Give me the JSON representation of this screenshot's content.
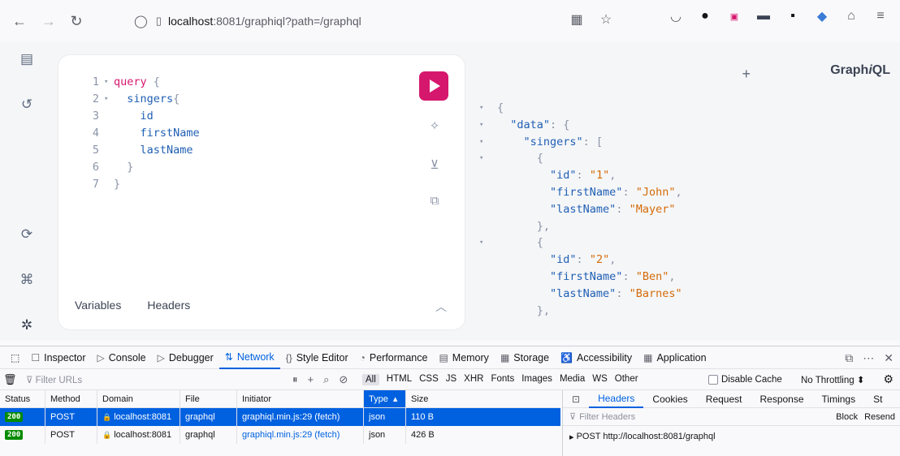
{
  "browser": {
    "url_host": "localhost",
    "url_rest": ":8081/graphiql?path=/graphql"
  },
  "editor": {
    "lines": [
      {
        "n": "1",
        "fold": "▾",
        "parts": [
          {
            "t": "query",
            "c": "kw"
          },
          {
            "t": " {",
            "c": "punc"
          }
        ]
      },
      {
        "n": "2",
        "fold": "▾",
        "parts": [
          {
            "t": "  singers",
            "c": "fld"
          },
          {
            "t": "{",
            "c": "punc"
          }
        ]
      },
      {
        "n": "3",
        "fold": "",
        "parts": [
          {
            "t": "    id",
            "c": "fld"
          }
        ]
      },
      {
        "n": "4",
        "fold": "",
        "parts": [
          {
            "t": "    firstName",
            "c": "fld"
          }
        ]
      },
      {
        "n": "5",
        "fold": "",
        "parts": [
          {
            "t": "    lastName",
            "c": "fld"
          }
        ]
      },
      {
        "n": "6",
        "fold": "",
        "parts": [
          {
            "t": "  }",
            "c": "punc"
          }
        ]
      },
      {
        "n": "7",
        "fold": "",
        "parts": [
          {
            "t": "}",
            "c": "punc"
          }
        ]
      }
    ],
    "tabs": [
      "Variables",
      "Headers"
    ]
  },
  "result": {
    "logo_prefix": "Graph",
    "logo_italic": "i",
    "logo_suffix": "QL",
    "lines": [
      {
        "fold": "▾",
        "parts": [
          {
            "t": "{",
            "c": "rpunc"
          }
        ]
      },
      {
        "fold": "▾",
        "parts": [
          {
            "t": "  ",
            "c": "rpunc"
          },
          {
            "t": "\"data\"",
            "c": "key"
          },
          {
            "t": ": {",
            "c": "rpunc"
          }
        ]
      },
      {
        "fold": "▾",
        "parts": [
          {
            "t": "    ",
            "c": "rpunc"
          },
          {
            "t": "\"singers\"",
            "c": "key"
          },
          {
            "t": ": [",
            "c": "rpunc"
          }
        ]
      },
      {
        "fold": "▾",
        "parts": [
          {
            "t": "      {",
            "c": "rpunc"
          }
        ]
      },
      {
        "fold": "",
        "parts": [
          {
            "t": "        ",
            "c": "rpunc"
          },
          {
            "t": "\"id\"",
            "c": "key"
          },
          {
            "t": ": ",
            "c": "rpunc"
          },
          {
            "t": "\"1\"",
            "c": "str"
          },
          {
            "t": ",",
            "c": "rpunc"
          }
        ]
      },
      {
        "fold": "",
        "parts": [
          {
            "t": "        ",
            "c": "rpunc"
          },
          {
            "t": "\"firstName\"",
            "c": "key"
          },
          {
            "t": ": ",
            "c": "rpunc"
          },
          {
            "t": "\"John\"",
            "c": "str"
          },
          {
            "t": ",",
            "c": "rpunc"
          }
        ]
      },
      {
        "fold": "",
        "parts": [
          {
            "t": "        ",
            "c": "rpunc"
          },
          {
            "t": "\"lastName\"",
            "c": "key"
          },
          {
            "t": ": ",
            "c": "rpunc"
          },
          {
            "t": "\"Mayer\"",
            "c": "str"
          }
        ]
      },
      {
        "fold": "",
        "parts": [
          {
            "t": "      },",
            "c": "rpunc"
          }
        ]
      },
      {
        "fold": "▾",
        "parts": [
          {
            "t": "      {",
            "c": "rpunc"
          }
        ]
      },
      {
        "fold": "",
        "parts": [
          {
            "t": "        ",
            "c": "rpunc"
          },
          {
            "t": "\"id\"",
            "c": "key"
          },
          {
            "t": ": ",
            "c": "rpunc"
          },
          {
            "t": "\"2\"",
            "c": "str"
          },
          {
            "t": ",",
            "c": "rpunc"
          }
        ]
      },
      {
        "fold": "",
        "parts": [
          {
            "t": "        ",
            "c": "rpunc"
          },
          {
            "t": "\"firstName\"",
            "c": "key"
          },
          {
            "t": ": ",
            "c": "rpunc"
          },
          {
            "t": "\"Ben\"",
            "c": "str"
          },
          {
            "t": ",",
            "c": "rpunc"
          }
        ]
      },
      {
        "fold": "",
        "parts": [
          {
            "t": "        ",
            "c": "rpunc"
          },
          {
            "t": "\"lastName\"",
            "c": "key"
          },
          {
            "t": ": ",
            "c": "rpunc"
          },
          {
            "t": "\"Barnes\"",
            "c": "str"
          }
        ]
      },
      {
        "fold": "",
        "parts": [
          {
            "t": "      },",
            "c": "rpunc"
          }
        ]
      }
    ]
  },
  "devtools": {
    "tabs": [
      {
        "label": "Inspector",
        "icon": "☐",
        "name": "inspector"
      },
      {
        "label": "Console",
        "icon": "▷",
        "name": "console"
      },
      {
        "label": "Debugger",
        "icon": "▷",
        "name": "debugger"
      },
      {
        "label": "Network",
        "icon": "⇅",
        "name": "network",
        "active": true
      },
      {
        "label": "Style Editor",
        "icon": "{}",
        "name": "style-editor"
      },
      {
        "label": "Performance",
        "icon": "◔",
        "name": "performance"
      },
      {
        "label": "Memory",
        "icon": "▤",
        "name": "memory"
      },
      {
        "label": "Storage",
        "icon": "▦",
        "name": "storage"
      },
      {
        "label": "Accessibility",
        "icon": "♿",
        "name": "accessibility"
      },
      {
        "label": "Application",
        "icon": "▦",
        "name": "application"
      }
    ],
    "filter_placeholder": "Filter URLs",
    "type_filters": [
      "All",
      "HTML",
      "CSS",
      "JS",
      "XHR",
      "Fonts",
      "Images",
      "Media",
      "WS",
      "Other"
    ],
    "disable_cache": "Disable Cache",
    "throttling": "No Throttling ⬍",
    "columns": [
      "Status",
      "Method",
      "Domain",
      "File",
      "Initiator",
      "Type",
      "Size"
    ],
    "rows": [
      {
        "status": "200",
        "method": "POST",
        "domain": "localhost:8081",
        "file": "graphql",
        "initiator": "graphiql.min.js:29 (fetch)",
        "type": "json",
        "size": "110 B",
        "selected": true
      },
      {
        "status": "200",
        "method": "POST",
        "domain": "localhost:8081",
        "file": "graphql",
        "initiator": "graphiql.min.js:29 (fetch)",
        "type": "json",
        "size": "426 B",
        "selected": false
      }
    ],
    "detail_tabs": [
      "Headers",
      "Cookies",
      "Request",
      "Response",
      "Timings",
      "St"
    ],
    "detail_filter": "Filter Headers",
    "block": "Block",
    "resend": "Resend",
    "post_line": "POST http://localhost:8081/graphql"
  }
}
